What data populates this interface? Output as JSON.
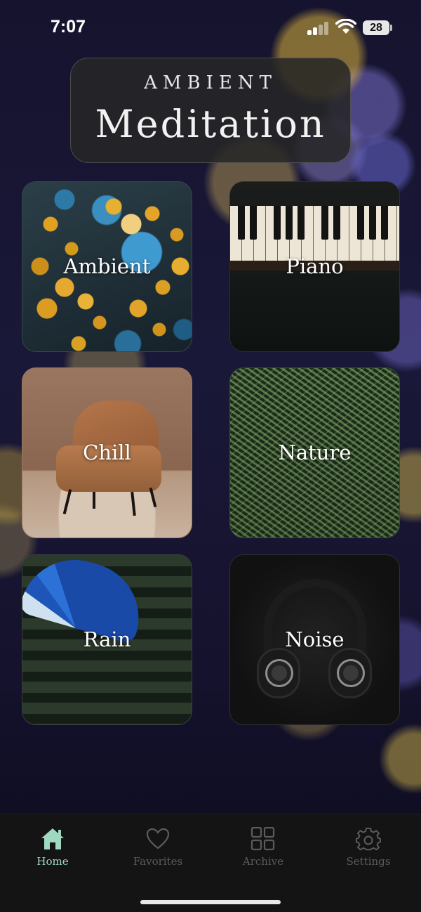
{
  "status_bar": {
    "time": "7:07",
    "battery": "28"
  },
  "header": {
    "subtitle": "AMBIENT",
    "title": "Meditation"
  },
  "categories": [
    {
      "label": "Ambient",
      "icon": "bokeh-lights-image"
    },
    {
      "label": "Piano",
      "icon": "piano-keys-image"
    },
    {
      "label": "Chill",
      "icon": "armchair-image"
    },
    {
      "label": "Nature",
      "icon": "fern-leaves-image"
    },
    {
      "label": "Rain",
      "icon": "umbrella-image"
    },
    {
      "label": "Noise",
      "icon": "headphones-image"
    }
  ],
  "tab_bar": {
    "active": "Home",
    "accent_color": "#a0d9c2",
    "inactive_color": "#5c5c5c",
    "items": [
      {
        "label": "Home",
        "icon": "home-icon"
      },
      {
        "label": "Favorites",
        "icon": "heart-icon"
      },
      {
        "label": "Archive",
        "icon": "grid-icon"
      },
      {
        "label": "Settings",
        "icon": "gear-icon"
      }
    ]
  }
}
